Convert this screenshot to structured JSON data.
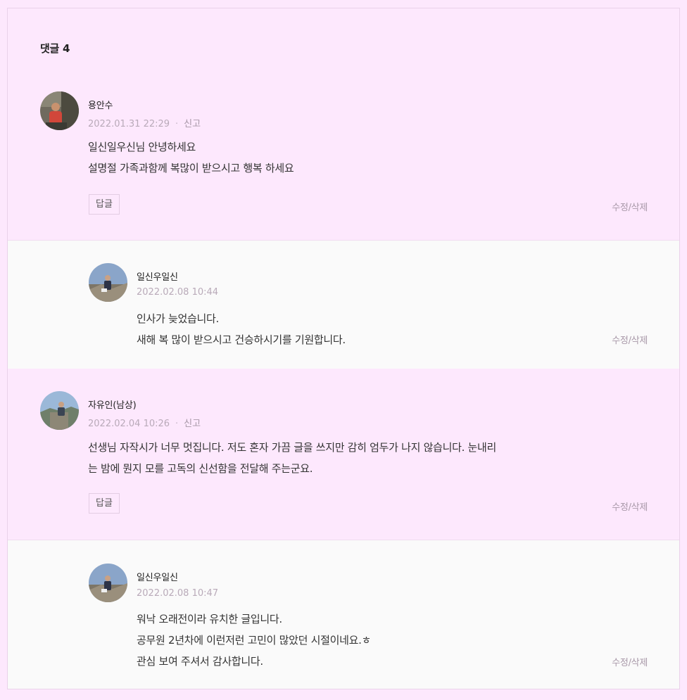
{
  "comments_header": {
    "label": "댓글",
    "count": "4"
  },
  "comments": [
    {
      "author": "용안수",
      "date": "2022.01.31 22:29",
      "report": "신고",
      "lines": [
        "일신일우신님 안녕하세요",
        "설명절 가족과함께 복많이 받으시고 행복 하세요"
      ],
      "reply_label": "답글",
      "edit_label": "수정/삭제"
    },
    {
      "author": "일신우일신",
      "date": "2022.02.08 10:44",
      "lines": [
        "인사가 늦었습니다.",
        "새해 복 많이 받으시고 건승하시기를 기원합니다."
      ],
      "edit_label": "수정/삭제"
    },
    {
      "author": "자유인(남상)",
      "date": "2022.02.04 10:26",
      "report": "신고",
      "lines": [
        "선생님 자작시가 너무 멋집니다. 저도 혼자 가끔 글을 쓰지만 감히 엄두가 나지 않습니다. 눈내리",
        "는 밤에 뭔지 모를 고독의 신선함을 전달해 주는군요."
      ],
      "reply_label": "답글",
      "edit_label": "수정/삭제"
    },
    {
      "author": "일신우일신",
      "date": "2022.02.08 10:47",
      "lines": [
        "워낙 오래전이라 유치한 글입니다.",
        "공무원 2년차에 이런저런 고민이 많았던 시절이네요.ㅎ",
        "관심 보여 주셔서 감사합니다."
      ],
      "edit_label": "수정/삭제"
    }
  ]
}
